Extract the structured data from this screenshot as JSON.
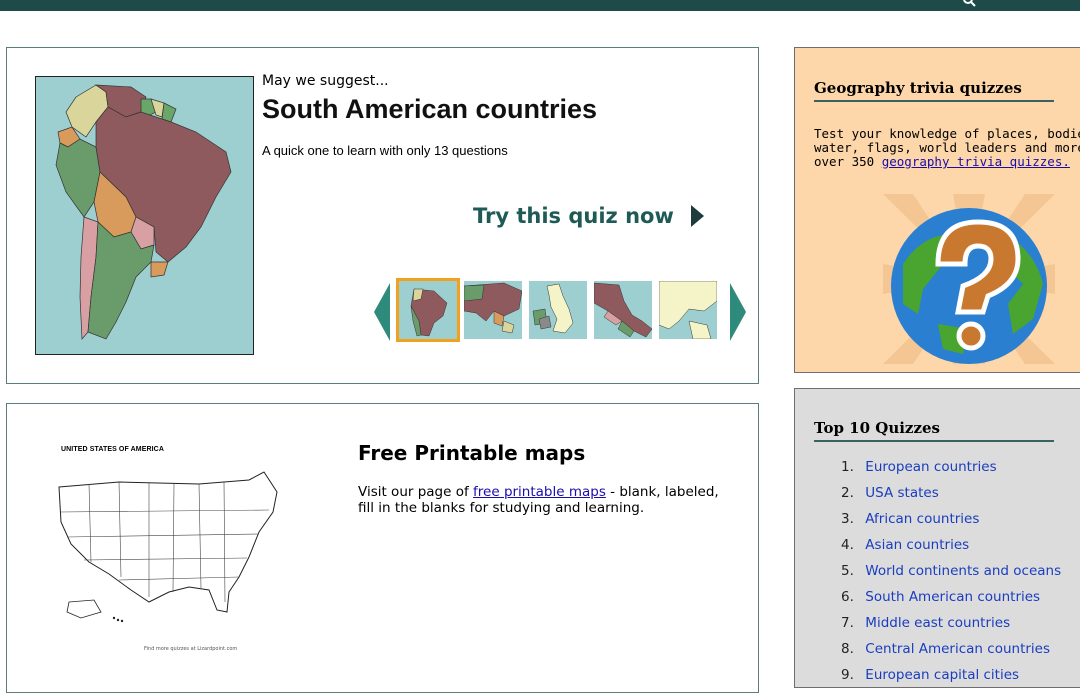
{
  "suggest": {
    "kicker": "May we suggest...",
    "title": "South American countries",
    "description": "A quick one to learn with only 13 questions",
    "cta": "Try this quiz now"
  },
  "printable": {
    "map_caption": "UNITED STATES OF AMERICA",
    "map_footer": "Find more quizzes at Lizardpoint.com",
    "title": "Free Printable maps",
    "desc_before": "Visit our page of ",
    "desc_link": "free printable maps",
    "desc_after": " - blank, labeled, fill in the blanks for studying and learning."
  },
  "trivia": {
    "heading": "Geography trivia quizzes",
    "line1": "Test your knowledge of places, bodie",
    "line2": "water, flags, world leaders and more",
    "line3_before": "over 350 ",
    "line3_link": "geography trivia quizzes."
  },
  "top10": {
    "heading": "Top 10 Quizzes",
    "items": [
      {
        "num": "1.",
        "label": "European countries"
      },
      {
        "num": "2.",
        "label": "USA states"
      },
      {
        "num": "3.",
        "label": "African countries"
      },
      {
        "num": "4.",
        "label": "Asian countries"
      },
      {
        "num": "5.",
        "label": "World continents and oceans"
      },
      {
        "num": "6.",
        "label": "South American countries"
      },
      {
        "num": "7.",
        "label": "Middle east countries"
      },
      {
        "num": "8.",
        "label": "Central American countries"
      },
      {
        "num": "9.",
        "label": "European capital cities"
      }
    ]
  },
  "icons": {
    "search": "search-icon",
    "prev": "chevron-left-icon",
    "next": "chevron-right-icon",
    "globe": "question-globe-icon"
  },
  "colors": {
    "topbar": "#1f4a4a",
    "accent": "#1e5a56",
    "carousel_arrow": "#2e8a7a",
    "active_thumb": "#f0a21f",
    "trivia_bg": "#fdd6a9",
    "top10_bg": "#dcdcdc",
    "link": "#1a3dbf"
  }
}
